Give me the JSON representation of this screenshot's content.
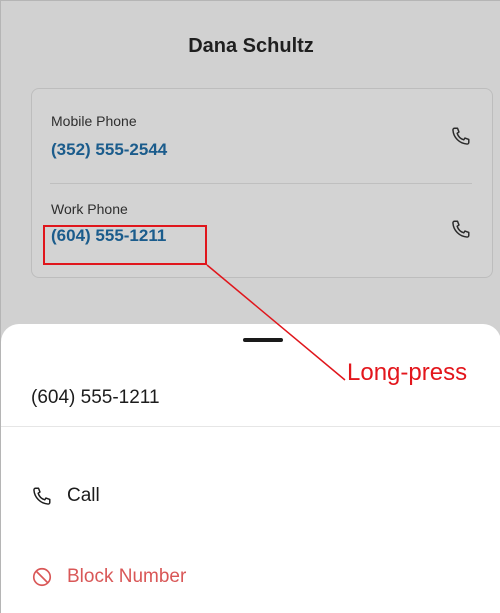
{
  "contact": {
    "name": "Dana Schultz"
  },
  "phones": [
    {
      "label": "Mobile Phone",
      "number": "(352) 555-2544"
    },
    {
      "label": "Work Phone",
      "number": "(604) 555-1211"
    }
  ],
  "sheet": {
    "title": "(604) 555-1211",
    "actions": [
      {
        "label": "Call",
        "icon": "phone-icon"
      },
      {
        "label": "Block Number",
        "icon": "block-icon"
      }
    ]
  },
  "annotation": {
    "label": "Long-press"
  },
  "colors": {
    "link_blue": "#1b5c8c",
    "danger_red": "#d95757",
    "annotation_red": "#e0161c"
  }
}
